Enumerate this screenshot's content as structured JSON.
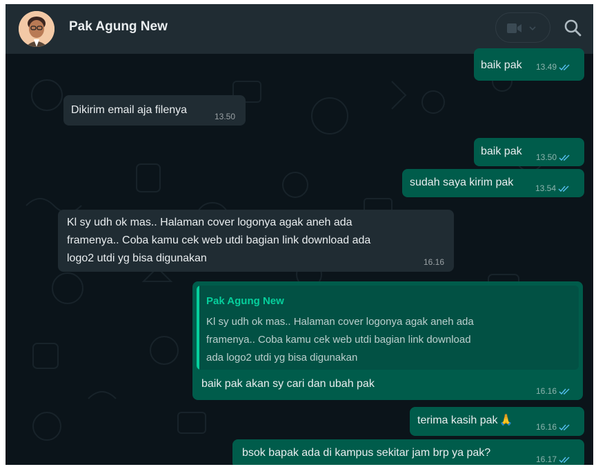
{
  "header": {
    "contact_name": "Pak Agung New"
  },
  "messages": [
    {
      "direction": "out",
      "text": "baik pak",
      "time": "13.49",
      "status": "read"
    },
    {
      "direction": "in",
      "text": "Dikirim email aja filenya",
      "time": "13.50"
    },
    {
      "direction": "out",
      "text": "baik pak",
      "time": "13.50",
      "status": "read"
    },
    {
      "direction": "out",
      "text": "sudah saya kirim pak",
      "time": "13.54",
      "status": "read"
    },
    {
      "direction": "in",
      "lines": [
        "Kl sy udh ok mas.. Halaman cover logonya agak aneh ada",
        "framenya.. Coba kamu cek web utdi bagian link download ada",
        "logo2 utdi yg bisa digunakan"
      ],
      "time": "16.16"
    },
    {
      "direction": "out",
      "reply_to": {
        "name": "Pak Agung New",
        "lines": [
          "Kl sy udh ok mas.. Halaman cover logonya agak aneh ada",
          "framenya.. Coba kamu cek web utdi bagian link download",
          "ada logo2 utdi yg bisa digunakan"
        ]
      },
      "text": "baik pak akan sy cari dan ubah pak",
      "time": "16.16",
      "status": "read"
    },
    {
      "direction": "out",
      "text": "terima kasih pak",
      "emoji": "🙏",
      "time": "16.16",
      "status": "read"
    },
    {
      "direction": "out",
      "text": "bsok bapak ada di kampus sekitar jam brp ya pak?",
      "time": "16.17",
      "status": "read"
    }
  ],
  "colors": {
    "header_bg": "#202c33",
    "chat_bg": "#0b141a",
    "outgoing_bubble": "#005c4b",
    "incoming_bubble": "#202c33",
    "read_tick": "#53bdeb",
    "quote_accent": "#06cf9c"
  },
  "icons": {
    "video_call": "video-camera-icon",
    "dropdown": "chevron-down-icon",
    "search": "search-icon",
    "read_receipt": "double-check-icon"
  }
}
